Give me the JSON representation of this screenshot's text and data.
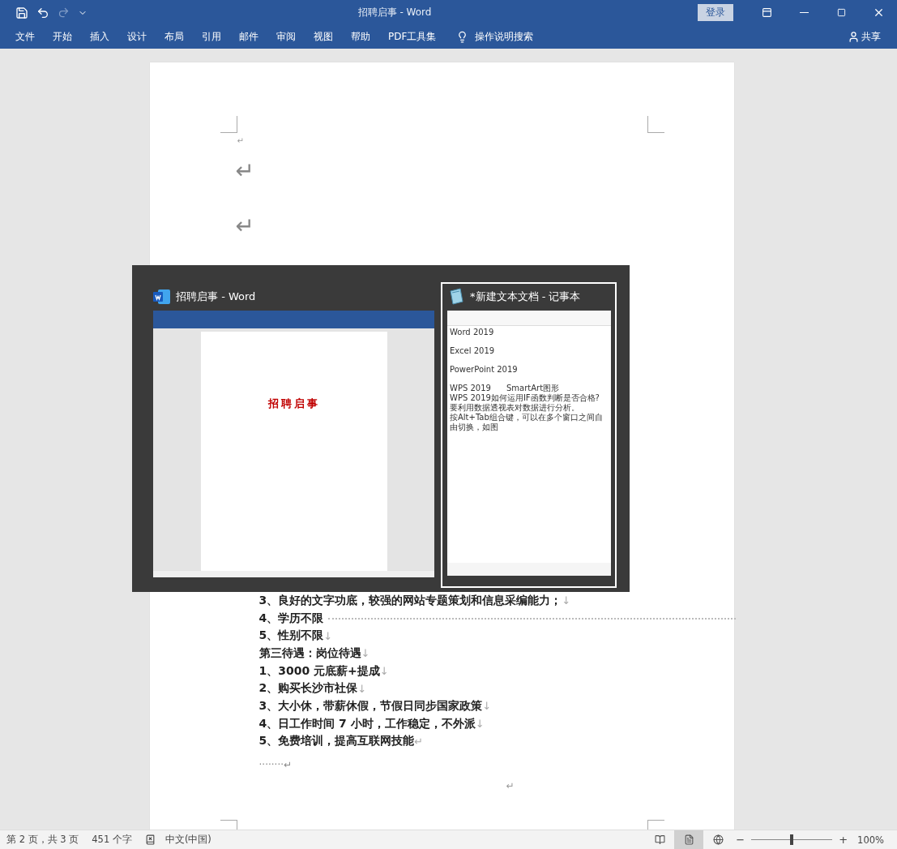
{
  "window": {
    "title": "招聘启事 - Word",
    "sign_in": "登录"
  },
  "quick_access": [
    {
      "kind": "save",
      "disabled": false
    },
    {
      "kind": "undo",
      "disabled": false
    },
    {
      "kind": "redo",
      "disabled": true
    },
    {
      "kind": "customize",
      "disabled": false
    }
  ],
  "ribbon_tabs": [
    "文件",
    "开始",
    "插入",
    "设计",
    "布局",
    "引用",
    "邮件",
    "审阅",
    "视图",
    "帮助",
    "PDF工具集"
  ],
  "tell_me": "操作说明搜索",
  "share": "共享",
  "document": {
    "top_marks": [
      "↵",
      "↵",
      "↵"
    ],
    "lines": [
      {
        "text": "3、良好的文字功底，较强的网站专题策划和信息采编能力；",
        "mark": "↓",
        "leader": false
      },
      {
        "text": "4、学历不限",
        "leader": true
      },
      {
        "text": "5、性别不限",
        "mark": "↓",
        "leader": false
      },
      {
        "text": "第三待遇：岗位待遇",
        "mark": "↓",
        "leader": false
      },
      {
        "text": "1、3000 元底薪+提成",
        "mark": "↓",
        "leader": false
      },
      {
        "text": "2、购买长沙市社保",
        "mark": "↓",
        "leader": false
      },
      {
        "text": "3、大小休，带薪休假，节假日同步国家政策",
        "mark": "↓",
        "leader": false
      },
      {
        "text": "4、日工作时间 7 小时，工作稳定，不外派",
        "mark": "↓",
        "leader": false
      },
      {
        "text": "5、免费培训，提高互联网技能",
        "mark": "↵",
        "leader": false
      }
    ],
    "dots": "········",
    "dots_mark": "↵",
    "end_mark": "↵"
  },
  "task_switcher": {
    "windows": [
      {
        "kind": "word",
        "title": "招聘启事 - Word",
        "selected": false,
        "preview_heading": "招聘启事"
      },
      {
        "kind": "notepad",
        "title": "*新建文本文档 - 记事本",
        "selected": true,
        "preview_paragraphs": [
          [
            "Word 2019"
          ],
          [
            "Excel 2019"
          ],
          [
            "PowerPoint 2019"
          ],
          [
            "WPS 2019      SmartArt图形",
            "WPS 2019如何运用IF函数判断是否合格?",
            "要利用数据透视表对数据进行分析。",
            "按Alt+Tab组合键，可以在多个窗口之间自由切换，如图"
          ]
        ]
      }
    ]
  },
  "status_bar": {
    "page": "第 2 页，共 3 页",
    "words": "451 个字",
    "language": "中文(中国)",
    "zoom_minus": "−",
    "zoom_plus": "+",
    "zoom": "100%",
    "zoom_slider": {
      "level": 0.5
    }
  }
}
